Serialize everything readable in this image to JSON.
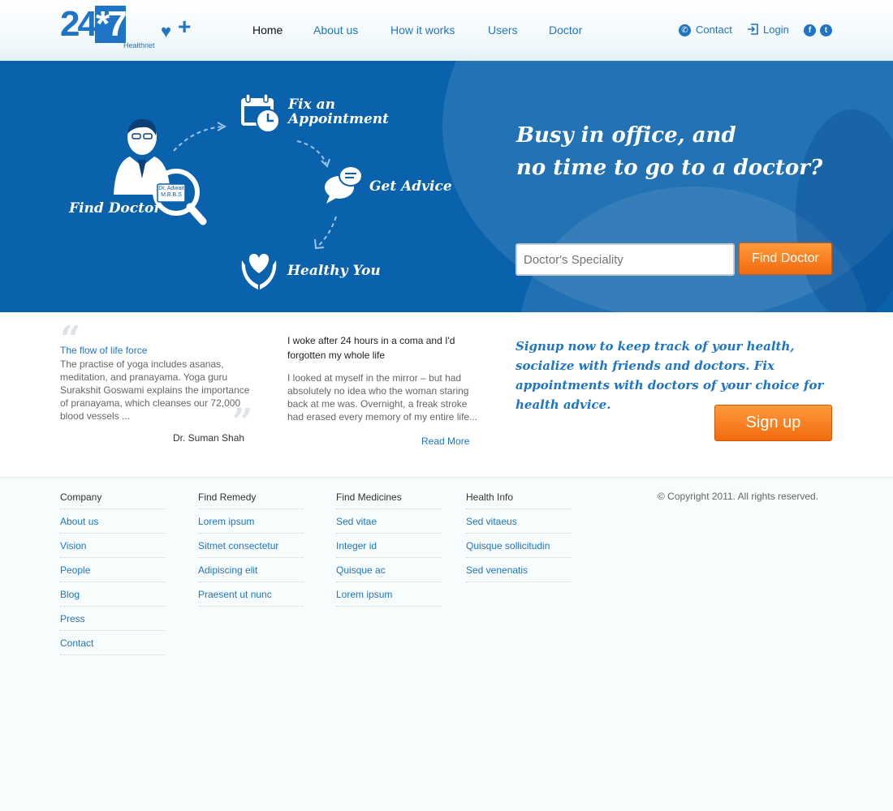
{
  "logo": {
    "text_a": "24",
    "text_b": "*7",
    "sub": "Healthnet",
    "plus": "+"
  },
  "nav": {
    "items": [
      "Home",
      "About us",
      "How it works",
      "Users",
      "Doctor"
    ],
    "active": "Home"
  },
  "utility": {
    "contact": "Contact",
    "login": "Login",
    "facebook": "f",
    "twitter": "t"
  },
  "hero": {
    "steps": {
      "find_doctor": "Find Doctor",
      "fix_appointment_line1": "Fix an",
      "fix_appointment_line2": "Appointment",
      "get_advice": "Get Advice",
      "healthy_you": "Healthy You"
    },
    "badge": {
      "name": "Dr. Adwait",
      "degree": "M.B.B.S"
    },
    "tagline_line1": "Busy in office, and",
    "tagline_line2": "no time to go to a doctor?",
    "search": {
      "placeholder": "Doctor's Speciality",
      "button": "Find Doctor"
    }
  },
  "testimonial": {
    "title": "The flow of life force",
    "text": "The practise of yoga includes asanas, meditation, and pranayama. Yoga guru Surakshit Goswami explains the importance of pranayama, which cleanses our 72,000 blood vessels ...",
    "author": "Dr. Suman Shah"
  },
  "story": {
    "title": "I woke after 24 hours in a coma and I'd forgotten my whole life",
    "text": "I looked at myself in the mirror – but had absolutely no idea who the woman staring back at me was. Overnight, a freak stroke had erased every memory of my entire life...",
    "read_more": "Read More"
  },
  "signup": {
    "text": "Signup now to keep track of your health, socialize with friends and doctors. Fix appointments with doctors of your choice for health advice.",
    "button": "Sign up"
  },
  "footer": {
    "columns": [
      {
        "heading": "Company",
        "links": [
          "About us",
          "Vision",
          "People",
          "Blog",
          "Press",
          "Contact"
        ]
      },
      {
        "heading": "Find Remedy",
        "links": [
          "Lorem ipsum",
          "Sitmet consectetur",
          "Adipiscing elit",
          "Praesent ut nunc"
        ]
      },
      {
        "heading": "Find Medicines",
        "links": [
          "Sed vitae",
          "Integer id",
          "Quisque ac",
          "Lorem ipsum"
        ]
      },
      {
        "heading": "Health Info",
        "links": [
          "Sed vitaeus",
          "Quisque sollicitudin",
          "Sed venenatis"
        ]
      }
    ],
    "copyright": "© Copyright 2011. All rights reserved."
  },
  "colors": {
    "brand_blue": "#1f74c6",
    "hero_blue": "#0b62ac",
    "accent_orange": "#f26a0e"
  }
}
